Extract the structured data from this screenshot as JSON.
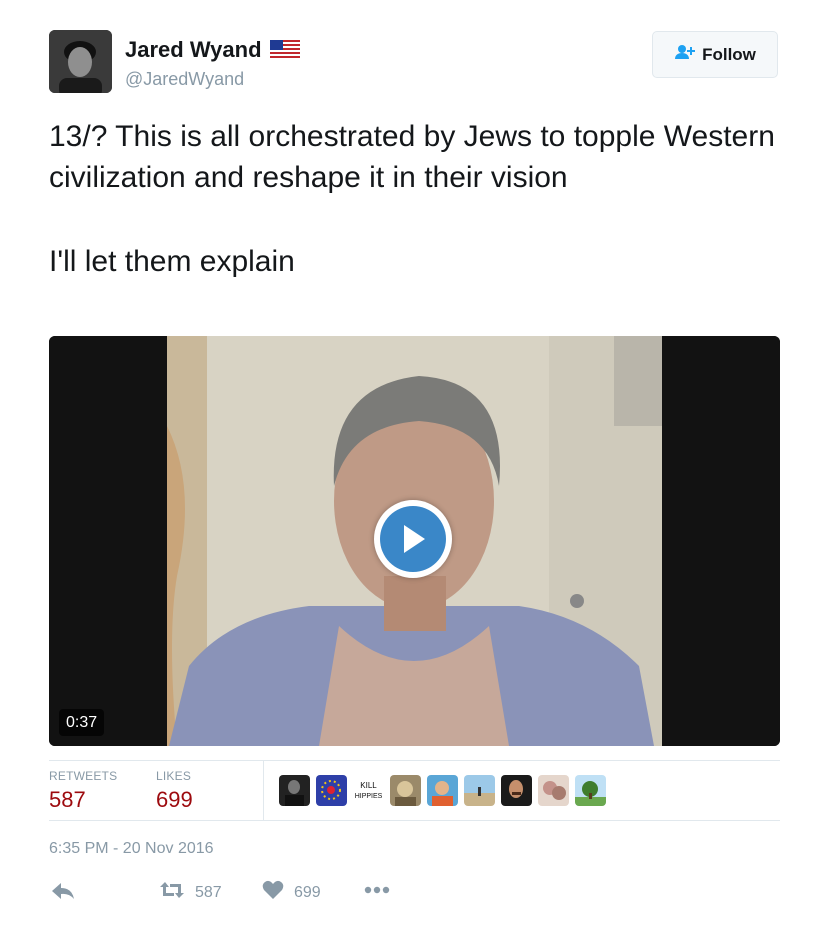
{
  "user": {
    "name": "Jared Wyand",
    "handle": "@JaredWyand",
    "flag_icon": "us-flag-icon"
  },
  "follow_button": {
    "label": "Follow",
    "icon": "add-user-icon"
  },
  "tweet": {
    "paragraphs": [
      "13/? This is all orchestrated by Jews to topple Western civilization and reshape it in their vision",
      "I'll let them explain"
    ]
  },
  "video": {
    "duration": "0:37",
    "play_icon": "play-icon"
  },
  "stats": {
    "retweets_label": "RETWEETS",
    "retweets_value": "587",
    "likes_label": "LIKES",
    "likes_value": "699",
    "liker_avatars": 9,
    "kill_hippies_text": "KILL HIPPIES"
  },
  "timestamp": "6:35 PM - 20 Nov 2016",
  "actions": {
    "reply_icon": "reply-icon",
    "retweet_icon": "retweet-icon",
    "retweet_count": "587",
    "like_icon": "heart-icon",
    "like_count": "699",
    "more_icon": "more-icon"
  },
  "colors": {
    "stat_value": "#9d0a0e",
    "muted": "#8899a6",
    "play_blue": "#3a87c8",
    "border": "#e1e8ed"
  }
}
